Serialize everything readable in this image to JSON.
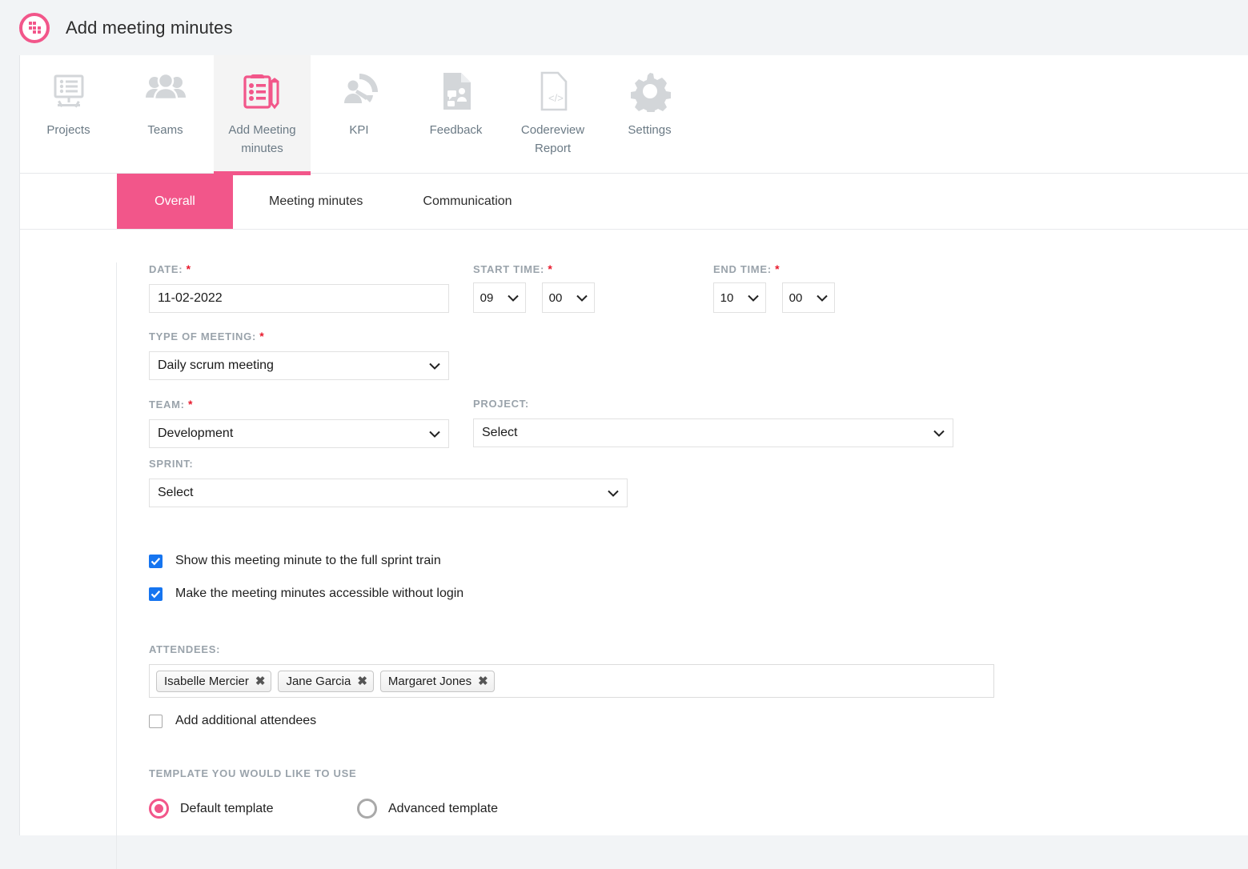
{
  "header": {
    "title": "Add meeting minutes",
    "logo_icon": "dot-grid-circle-logo"
  },
  "iconnav": {
    "items": [
      {
        "label": "Projects",
        "icon": "presentation-board-icon",
        "active": false
      },
      {
        "label": "Teams",
        "icon": "people-group-icon",
        "active": false
      },
      {
        "label": "Add Meeting minutes",
        "icon": "clipboard-pencil-icon",
        "active": true
      },
      {
        "label": "KPI",
        "icon": "speedometer-person-icon",
        "active": false
      },
      {
        "label": "Feedback",
        "icon": "document-chat-icon",
        "active": false
      },
      {
        "label": "Codereview Report",
        "icon": "document-code-icon",
        "active": false
      },
      {
        "label": "Settings",
        "icon": "gear-icon",
        "active": false
      }
    ]
  },
  "subtabs": {
    "items": [
      {
        "label": "Overall",
        "active": true
      },
      {
        "label": "Meeting minutes",
        "active": false
      },
      {
        "label": "Communication",
        "active": false
      }
    ]
  },
  "form": {
    "date": {
      "label": "DATE:",
      "required": "*",
      "value": "11-02-2022"
    },
    "start_time": {
      "label": "START TIME:",
      "required": "*",
      "hour": "09",
      "minute": "00"
    },
    "end_time": {
      "label": "END TIME:",
      "required": "*",
      "hour": "10",
      "minute": "00"
    },
    "type_of_meeting": {
      "label": "TYPE OF MEETING:",
      "required": "*",
      "value": "Daily scrum meeting"
    },
    "team": {
      "label": "TEAM:",
      "required": "*",
      "value": "Development"
    },
    "project": {
      "label": "PROJECT:",
      "value": "Select"
    },
    "sprint": {
      "label": "SPRINT:",
      "value": "Select"
    },
    "checkboxes": [
      {
        "label": "Show this meeting minute to the full sprint train",
        "checked": true
      },
      {
        "label": "Make the meeting minutes accessible without login",
        "checked": true
      }
    ],
    "attendees": {
      "label": "ATTENDEES:",
      "tags": [
        "Isabelle Mercier",
        "Jane Garcia",
        "Margaret Jones"
      ],
      "remove_glyph": "✖",
      "add_more": {
        "label": "Add additional attendees",
        "checked": false
      }
    },
    "template": {
      "label": "TEMPLATE YOU WOULD LIKE TO USE",
      "options": [
        {
          "label": "Default template",
          "selected": true
        },
        {
          "label": "Advanced template",
          "selected": false
        }
      ]
    }
  },
  "colors": {
    "accent_pink": "#f2568a",
    "required_red": "#e8192c",
    "checkbox_blue": "#1675f0",
    "label_gray": "#9aa3ab",
    "page_bg": "#f2f4f6"
  }
}
